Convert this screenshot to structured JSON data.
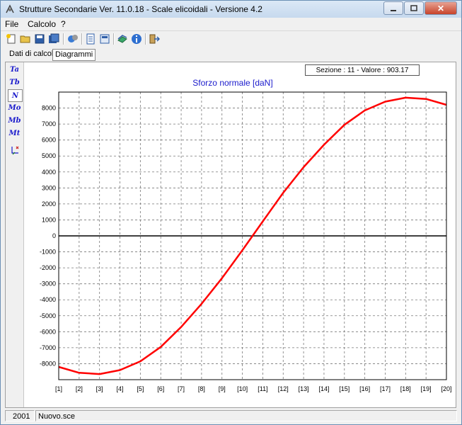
{
  "window": {
    "title": "Strutture Secondarie Ver. 11.0.18 - Scale elicoidali - Versione 4.2",
    "minimize_icon": "minimize-icon",
    "maximize_icon": "maximize-icon",
    "close_label": "✕"
  },
  "menu": {
    "items": [
      {
        "label": "File"
      },
      {
        "label": "Calcolo"
      },
      {
        "label": "?"
      }
    ]
  },
  "toolbar": {
    "icons": [
      "new-file-icon",
      "open-folder-icon",
      "save-icon",
      "save-as-icon",
      "calculate-icon",
      "report-icon",
      "print-preview-icon",
      "library-icon",
      "info-icon",
      "exit-icon"
    ]
  },
  "tabs": [
    {
      "label": "Dati di calcolo",
      "active": false
    },
    {
      "label": "Diagrammi",
      "active": true
    }
  ],
  "sidebar": {
    "items": [
      {
        "label": "Ta",
        "active": false
      },
      {
        "label": "Tb",
        "active": false
      },
      {
        "label": "N",
        "active": true
      },
      {
        "label": "Mo",
        "active": false
      },
      {
        "label": "Mb",
        "active": false
      },
      {
        "label": "Mt",
        "active": false
      },
      {
        "label": "",
        "icon": "axis-settings-icon",
        "active": false
      }
    ]
  },
  "info": {
    "text": "Sezione : 11 - Valore : 903.17"
  },
  "chart_data": {
    "type": "line",
    "title": "Sforzo normale [daN]",
    "xlabel": "",
    "ylabel": "",
    "categories": [
      "[1]",
      "[2]",
      "[3]",
      "[4]",
      "[5]",
      "[6]",
      "[7]",
      "[8]",
      "[9]",
      "[10]",
      "[11]",
      "[12]",
      "[13]",
      "[14]",
      "[15]",
      "[16]",
      "[17]",
      "[18]",
      "[19]",
      "[20]"
    ],
    "series": [
      {
        "color": "#ff0000",
        "values": [
          -8200,
          -8570,
          -8650,
          -8400,
          -7850,
          -6950,
          -5700,
          -4250,
          -2650,
          -900,
          903.17,
          2700,
          4300,
          5700,
          6950,
          7850,
          8400,
          8650,
          8570,
          8200
        ]
      }
    ],
    "yticks": [
      8000,
      7000,
      6000,
      5000,
      4000,
      3000,
      2000,
      1000,
      0,
      -1000,
      -2000,
      -3000,
      -4000,
      -5000,
      -6000,
      -7000,
      -8000
    ],
    "ylim": [
      -9000,
      9000
    ],
    "grid": true,
    "legend": "none"
  },
  "status": {
    "left": "2001",
    "file": "Nuovo.sce"
  }
}
